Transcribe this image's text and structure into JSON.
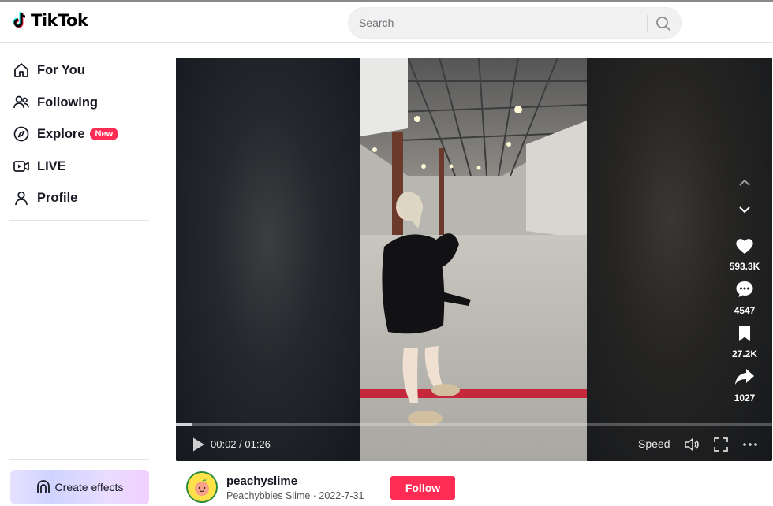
{
  "header": {
    "app_name": "TikTok",
    "search_placeholder": "Search"
  },
  "sidebar": {
    "items": [
      {
        "label": "For You",
        "icon": "home-icon"
      },
      {
        "label": "Following",
        "icon": "people-icon"
      },
      {
        "label": "Explore",
        "icon": "compass-icon",
        "badge": "New"
      },
      {
        "label": "LIVE",
        "icon": "live-icon"
      },
      {
        "label": "Profile",
        "icon": "user-icon"
      }
    ],
    "create_effects_label": "Create effects"
  },
  "player": {
    "time_display": "00:02 / 01:26",
    "speed_label": "Speed",
    "progress": 0.026,
    "stats": {
      "likes": "593.3K",
      "comments": "4547",
      "saves": "27.2K",
      "shares": "1027"
    }
  },
  "author": {
    "username": "peachyslime",
    "subtitle": "Peachybbies Slime · 2022-7-31",
    "follow_label": "Follow"
  },
  "colors": {
    "accent": "#fe2c55",
    "player_bg": "#161c24"
  }
}
